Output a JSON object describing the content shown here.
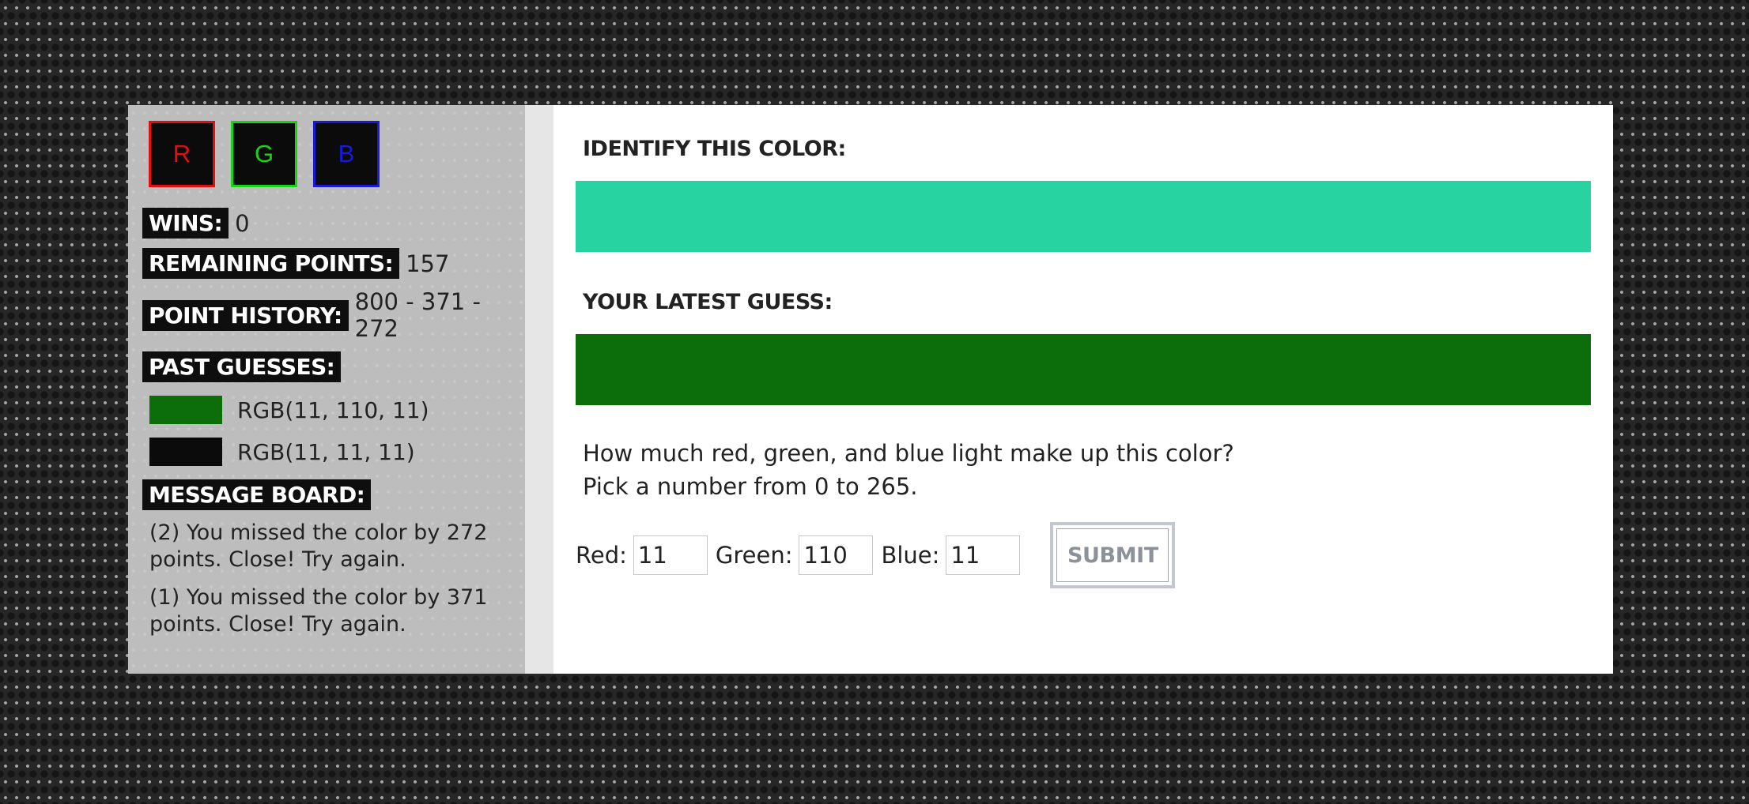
{
  "logo": {
    "letters": [
      {
        "label": "R",
        "color": "#e01010"
      },
      {
        "label": "G",
        "color": "#17d417"
      },
      {
        "label": "B",
        "color": "#1a1ad6"
      }
    ]
  },
  "sidebar": {
    "wins_label": "WINS:",
    "wins_value": "0",
    "remaining_label": "REMAINING POINTS:",
    "remaining_value": "157",
    "history_label": "POINT HISTORY:",
    "history_value": "800 - 371 - 272",
    "past_label": "PAST GUESSES:",
    "past_guesses": [
      {
        "label": "RGB(11, 110, 11)",
        "color": "#0b6e0b"
      },
      {
        "label": "RGB(11, 11, 11)",
        "color": "#0b0b0b"
      }
    ],
    "message_label": "MESSAGE BOARD:",
    "messages": [
      "(2) You missed the color by 272 points. Close! Try again.",
      "(1) You missed the color by 371 points. Close! Try again."
    ]
  },
  "main": {
    "identify_title": "IDENTIFY THIS COLOR:",
    "target_color": "#26d3a1",
    "latest_title": "YOUR LATEST GUESS:",
    "latest_color": "#0b6e0b",
    "question_line1": "How much red, green, and blue light make up this color?",
    "question_line2": "Pick a number from 0 to 265.",
    "red_label": "Red:",
    "red_value": "11",
    "green_label": "Green:",
    "green_value": "110",
    "blue_label": "Blue:",
    "blue_value": "11",
    "submit_label": "SUBMIT"
  }
}
